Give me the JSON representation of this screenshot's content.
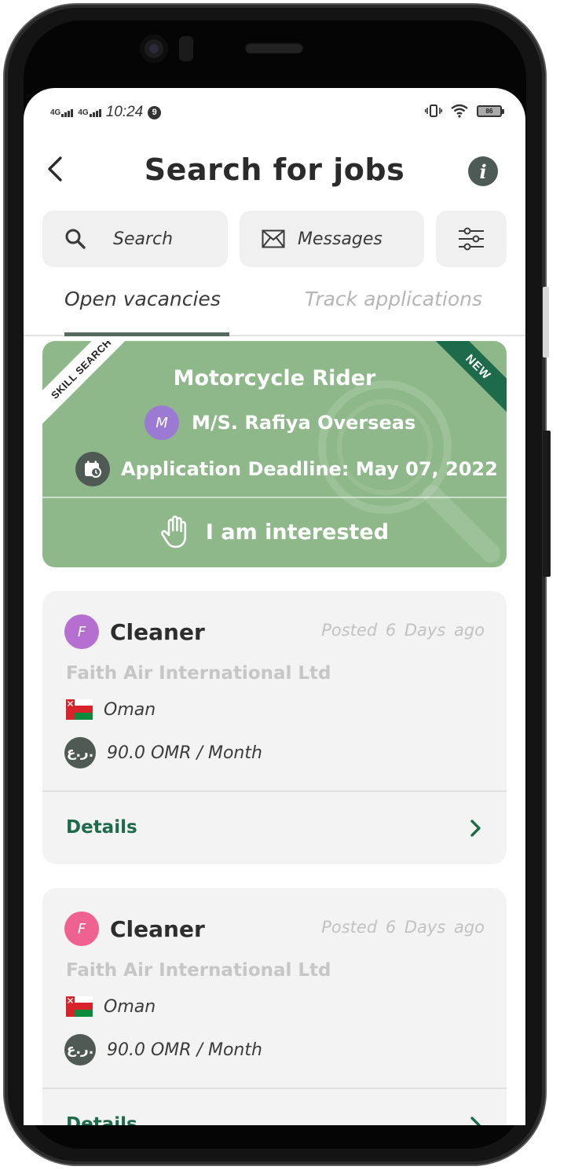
{
  "status_bar": {
    "network_1": "4G",
    "network_2": "4G",
    "time": "10:24",
    "notification_badge": "9",
    "battery": "86"
  },
  "header": {
    "title": "Search for jobs",
    "info_icon": "i"
  },
  "actions": {
    "search_label": "Search",
    "messages_label": "Messages"
  },
  "tabs": [
    {
      "label": "Open vacancies",
      "active": true
    },
    {
      "label": "Track applications",
      "active": false
    }
  ],
  "featured": {
    "ribbon_left": "SKILL SEARCH",
    "ribbon_right": "NEW",
    "title": "Motorcycle Rider",
    "company_initial": "M",
    "company": "M/S. Rafiya Overseas",
    "deadline": "Application Deadline: May 07, 2022",
    "action_label": "I am interested",
    "colors": {
      "background": "#8fb88a",
      "ribbon_right": "#1e6b4b",
      "avatar": "#9a7ad3"
    }
  },
  "jobs": [
    {
      "initial": "F",
      "avatar_color": "#b46fd0",
      "title": "Cleaner",
      "posted": "Posted 6 Days  ago",
      "company": "Faith Air International Ltd",
      "country": "Oman",
      "currency_symbol": "ر.ع.",
      "salary": "90.0 OMR / Month",
      "details_label": "Details"
    },
    {
      "initial": "F",
      "avatar_color": "#ef6191",
      "title": "Cleaner",
      "posted": "Posted 6 Days  ago",
      "company": "Faith Air International Ltd",
      "country": "Oman",
      "currency_symbol": "ر.ع.",
      "salary": "90.0 OMR / Month",
      "details_label": "Details"
    }
  ]
}
